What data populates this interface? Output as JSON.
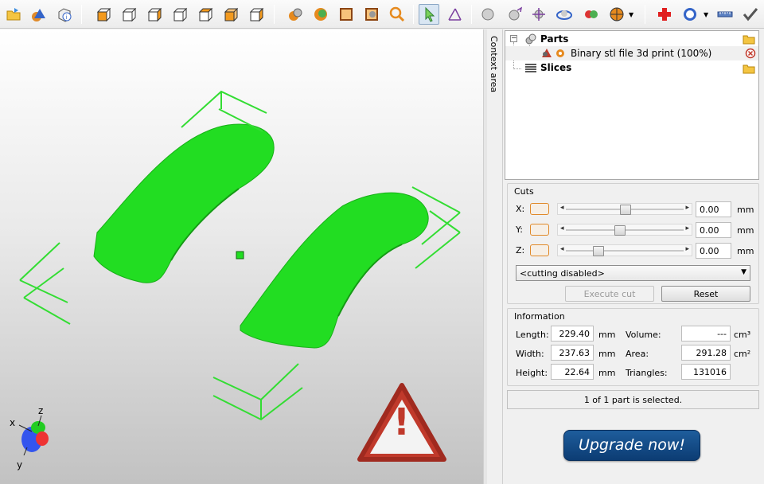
{
  "toolbar": {
    "icons": [
      "open-file-icon",
      "add-primitive-icon",
      "part-info-icon",
      "view-front-icon",
      "view-back-icon",
      "view-left-icon",
      "view-right-icon",
      "view-top-icon",
      "view-bottom-icon",
      "view-iso-icon",
      "render-solid-icon",
      "render-shaded-icon",
      "render-wireframe-icon",
      "render-box-icon",
      "zoom-icon",
      "select-pointer-icon",
      "measure-icon",
      "sphere-icon",
      "move-part-icon",
      "scale-part-icon",
      "rotate-part-icon",
      "mirror-part-icon",
      "color-part-icon",
      "section-chart-icon",
      "add-red-cross-icon",
      "settings-gauge-icon",
      "ruler-icon",
      "checkmark-icon"
    ]
  },
  "context_tab": {
    "label": "Context area"
  },
  "tree": {
    "parts_label": "Parts",
    "part_item": "Binary stl file 3d print (100%)",
    "slices_label": "Slices",
    "expander": "−"
  },
  "cuts": {
    "title": "Cuts",
    "rows": [
      {
        "axis": "X:",
        "value": "0.00",
        "unit": "mm",
        "slider_pos": 0.5
      },
      {
        "axis": "Y:",
        "value": "0.00",
        "unit": "mm",
        "slider_pos": 0.45
      },
      {
        "axis": "Z:",
        "value": "0.00",
        "unit": "mm",
        "slider_pos": 0.25
      }
    ],
    "mode": "<cutting disabled>",
    "execute_label": "Execute cut",
    "reset_label": "Reset"
  },
  "info": {
    "title": "Information",
    "length_label": "Length:",
    "length": "229.40",
    "length_unit": "mm",
    "width_label": "Width:",
    "width": "237.63",
    "width_unit": "mm",
    "height_label": "Height:",
    "height": "22.64",
    "height_unit": "mm",
    "volume_label": "Volume:",
    "volume": "---",
    "volume_unit": "cm³",
    "area_label": "Area:",
    "area": "291.28",
    "area_unit": "cm²",
    "triangles_label": "Triangles:",
    "triangles": "131016"
  },
  "status": "1 of 1 part is selected.",
  "upgrade_label": "Upgrade now!",
  "axis_labels": {
    "x": "x",
    "y": "y",
    "z": "z"
  },
  "warning": {
    "symbol": "!"
  },
  "colors": {
    "model": "#22dd22",
    "accent_orange": "#e68a1e",
    "upgrade_blue": "#0f4a86",
    "warning_red": "#c0392b"
  }
}
